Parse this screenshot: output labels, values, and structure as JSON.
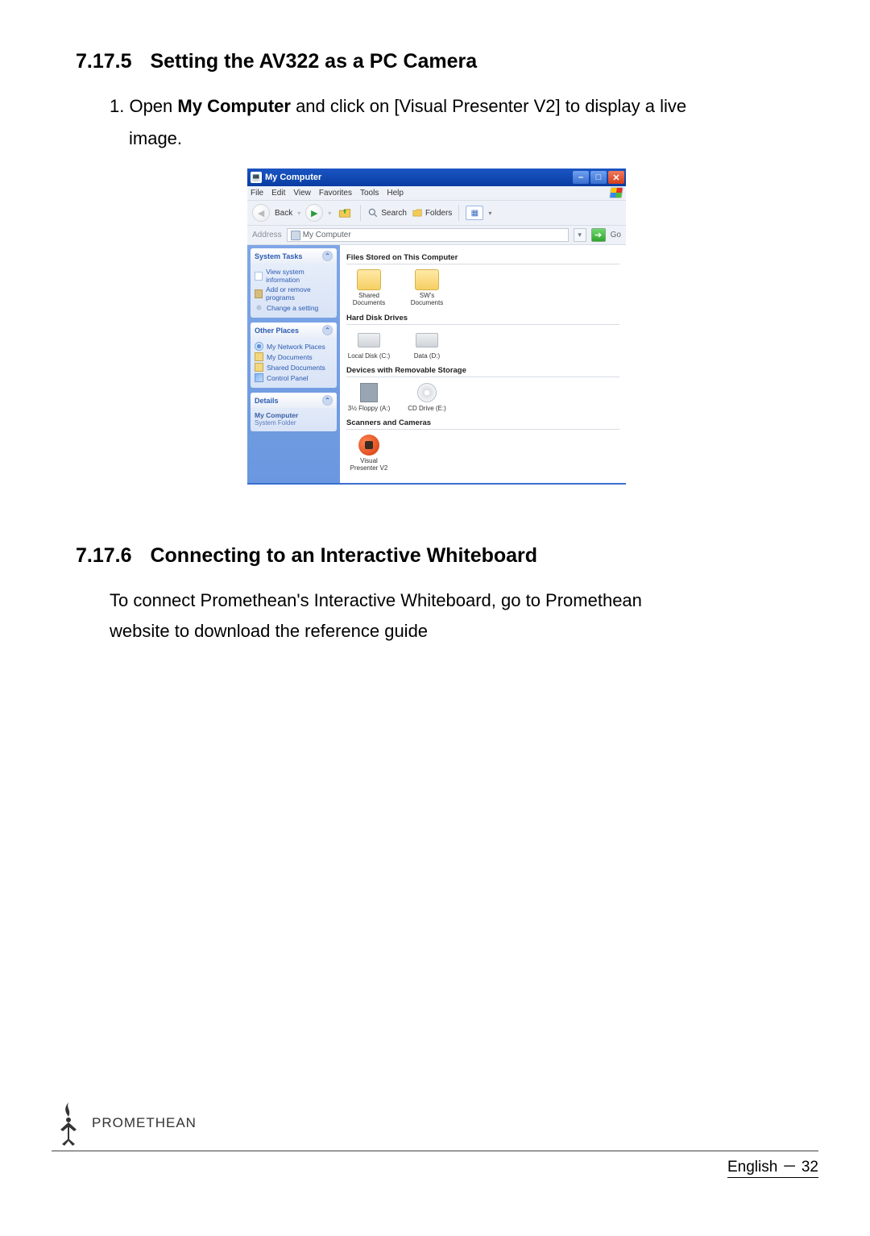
{
  "sections": {
    "s1": {
      "num": "7.17.5",
      "title": "Setting the AV322 as a PC Camera"
    },
    "s2": {
      "num": "7.17.6",
      "title": "Connecting to an Interactive Whiteboard"
    }
  },
  "step": {
    "prefix": "1.  Open ",
    "bold1": "My Computer",
    "mid": " and click on [Visual Presenter V2] to display a live",
    "line2": "image."
  },
  "para2": {
    "line1": "To connect Promethean's Interactive Whiteboard, go to Promethean",
    "line2": "website to download the reference guide"
  },
  "screenshot": {
    "title": "My Computer",
    "window_buttons": {
      "min": "–",
      "max": "□",
      "close": "✕"
    },
    "menus": [
      "File",
      "Edit",
      "View",
      "Favorites",
      "Tools",
      "Help"
    ],
    "toolbar": {
      "back": "Back",
      "search": "Search",
      "folders": "Folders",
      "views_dd": "▾"
    },
    "addressbar": {
      "label": "Address",
      "value": "My Computer",
      "go": "Go",
      "dd": "▾"
    },
    "side": {
      "system_tasks": {
        "title": "System Tasks",
        "links": [
          "View system information",
          "Add or remove programs",
          "Change a setting"
        ]
      },
      "other_places": {
        "title": "Other Places",
        "links": [
          "My Network Places",
          "My Documents",
          "Shared Documents",
          "Control Panel"
        ]
      },
      "details": {
        "title": "Details",
        "name": "My Computer",
        "type": "System Folder"
      }
    },
    "groups": {
      "files": {
        "title": "Files Stored on This Computer",
        "items": [
          {
            "label": "Shared Documents"
          },
          {
            "label": "SW's Documents"
          }
        ]
      },
      "hdd": {
        "title": "Hard Disk Drives",
        "items": [
          {
            "label": "Local Disk (C:)"
          },
          {
            "label": "Data (D:)"
          }
        ]
      },
      "removable": {
        "title": "Devices with Removable Storage",
        "items": [
          {
            "label": "3½ Floppy (A:)"
          },
          {
            "label": "CD Drive (E:)"
          }
        ]
      },
      "scanners": {
        "title": "Scanners and Cameras",
        "items": [
          {
            "label": "Visual Presenter V2"
          }
        ]
      }
    }
  },
  "footer": {
    "brand": "PROMETHEAN",
    "page": "English － 32"
  }
}
